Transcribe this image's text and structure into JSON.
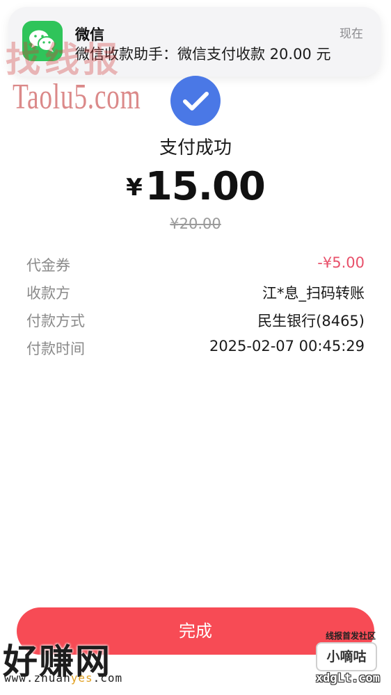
{
  "notification": {
    "app": "微信",
    "time": "现在",
    "body": "微信收款助手：微信支付收款 20.00 元"
  },
  "payment": {
    "status": "支付成功",
    "currency_symbol": "¥",
    "amount": "15.00",
    "original_amount": "¥20.00"
  },
  "details": [
    {
      "label": "代金券",
      "value": "-¥5.00"
    },
    {
      "label": "收款方",
      "value": "江*息_扫码转账"
    },
    {
      "label": "付款方式",
      "value": "民生银行(8465)"
    },
    {
      "label": "付款时间",
      "value": "2025-02-07 00:45:29"
    }
  ],
  "done_button": "完成",
  "watermarks": {
    "top_cn": "找线报",
    "taolu": "Taolu5.com",
    "bottom_cn": "好赚网",
    "bottom_url_a": "www.zhuan",
    "bottom_url_b": "yes",
    "bottom_url_c": ".com",
    "xd_line": "线报首发社区",
    "xd_box": "小嘀咕",
    "xd_url": "xdgLt.com"
  },
  "colors": {
    "check_blue": "#4a78e6",
    "done_red": "#f74b55",
    "discount_pink": "#e8506a",
    "wechat_green": "#2fc45a"
  }
}
